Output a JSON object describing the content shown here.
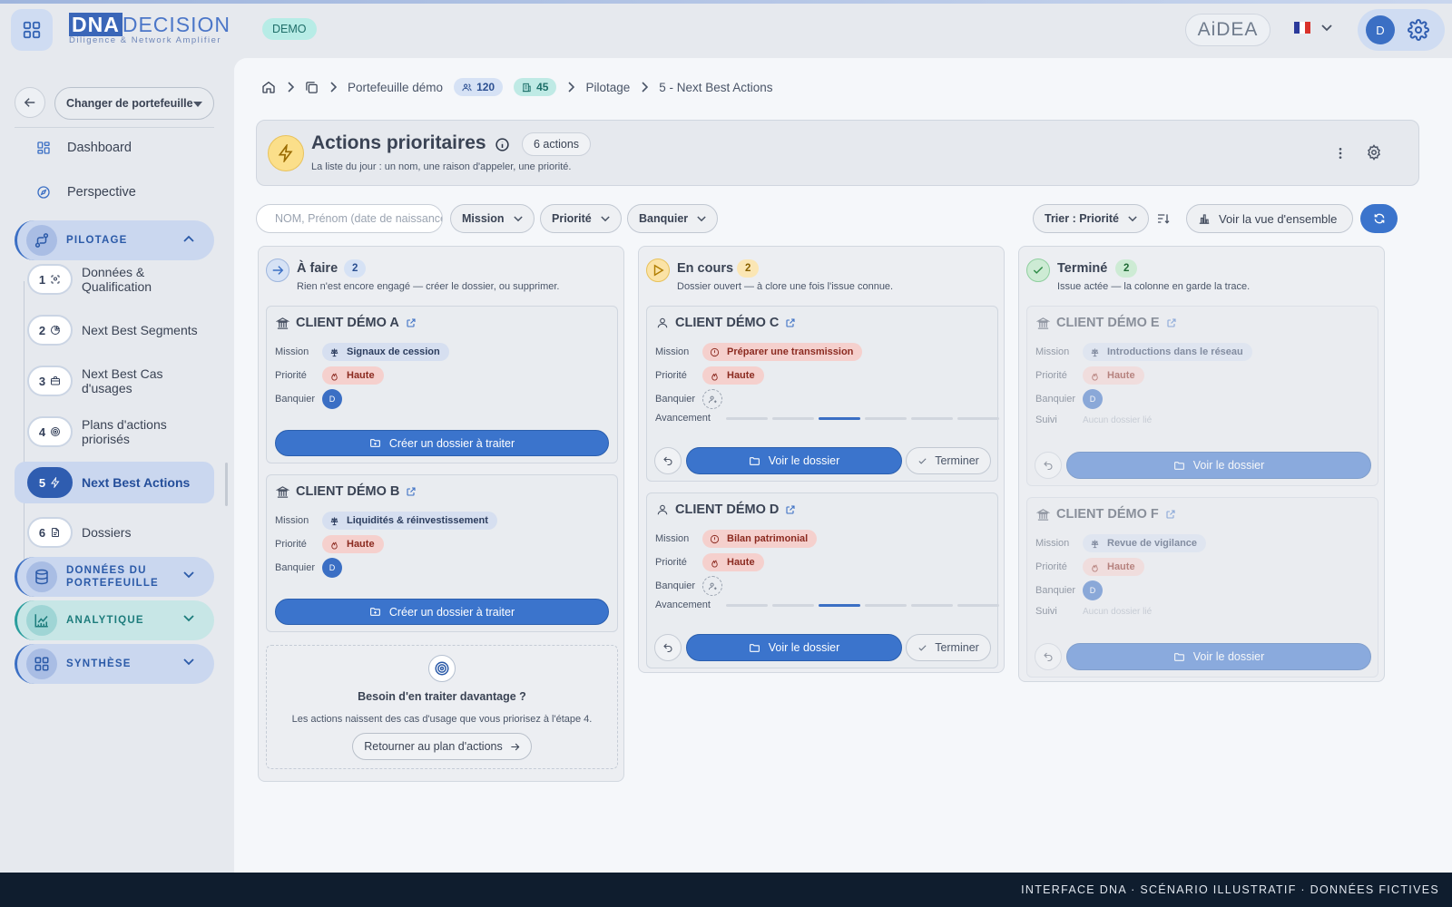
{
  "app": {
    "logo_main_a": "DNA",
    "logo_main_b": "DECISION",
    "logo_sub": "Diligence & Network Amplifier",
    "env_badge": "DEMO",
    "assistant_label": "AiDEA",
    "user_initial": "D"
  },
  "sidebar": {
    "portfolio_button": "Changer de portefeuille",
    "items": [
      {
        "label": "Dashboard",
        "icon": "dashboard-icon"
      },
      {
        "label": "Perspective",
        "icon": "compass-icon"
      }
    ],
    "section_pilotage": "PILOTAGE",
    "steps": [
      {
        "num": "1",
        "label": "Données & Qualification",
        "icon": "scan-icon"
      },
      {
        "num": "2",
        "label": "Next Best Segments",
        "icon": "pie-chart-icon"
      },
      {
        "num": "3",
        "label": "Next Best Cas d'usages",
        "icon": "briefcase-icon"
      },
      {
        "num": "4",
        "label": "Plans d'actions priorisés",
        "icon": "target-icon"
      },
      {
        "num": "5",
        "label": "Next Best Actions",
        "icon": "bolt-icon"
      },
      {
        "num": "6",
        "label": "Dossiers",
        "icon": "document-icon"
      }
    ],
    "sections": [
      {
        "label": "DONNÉES DU PORTEFEUILLE",
        "icon": "database-icon"
      },
      {
        "label": "ANALYTIQUE",
        "icon": "chart-icon"
      },
      {
        "label": "SYNTHÈSE",
        "icon": "grid-icon"
      }
    ]
  },
  "breadcrumb": {
    "portfolio": "Portefeuille démo",
    "people_count": "120",
    "company_count": "45",
    "section": "Pilotage",
    "page": "5 - Next Best Actions"
  },
  "header": {
    "title": "Actions prioritaires",
    "count": "6 actions",
    "subtitle": "La liste du jour : un nom, une raison d'appeler, une priorité."
  },
  "filters": {
    "search_placeholder": "NOM, Prénom (date de naissance)",
    "mission": "Mission",
    "priority": "Priorité",
    "banker": "Banquier",
    "sort": "Trier : Priorité",
    "overview": "Voir la vue d'ensemble"
  },
  "labels": {
    "mission": "Mission",
    "priority": "Priorité",
    "banker": "Banquier",
    "progress": "Avancement",
    "followup": "Suivi",
    "create": "Créer un dossier à traiter",
    "view": "Voir le dossier",
    "finish": "Terminer",
    "no_file": "Aucun dossier lié"
  },
  "columns": [
    {
      "title": "À faire",
      "count": "2",
      "subtitle": "Rien n'est encore engagé — créer le dossier, ou supprimer.",
      "cards": [
        {
          "name": "CLIENT DÉMO A",
          "mission": "Signaux de cession",
          "priority": "Haute",
          "banker": "D"
        },
        {
          "name": "CLIENT DÉMO B",
          "mission": "Liquidités & réinvestissement",
          "priority": "Haute",
          "banker": "D"
        }
      ]
    },
    {
      "title": "En cours",
      "count": "2",
      "subtitle": "Dossier ouvert — à clore une fois l'issue connue.",
      "cards": [
        {
          "name": "CLIENT DÉMO C",
          "mission": "Préparer une transmission",
          "priority": "Haute",
          "progress_step": 3,
          "progress_total": 6
        },
        {
          "name": "CLIENT DÉMO D",
          "mission": "Bilan patrimonial",
          "priority": "Haute",
          "progress_step": 3,
          "progress_total": 6
        }
      ]
    },
    {
      "title": "Terminé",
      "count": "2",
      "subtitle": "Issue actée — la colonne en garde la trace.",
      "cards": [
        {
          "name": "CLIENT DÉMO E",
          "mission": "Introductions dans le réseau",
          "priority": "Haute",
          "banker": "D"
        },
        {
          "name": "CLIENT DÉMO F",
          "mission": "Revue de vigilance",
          "priority": "Haute",
          "banker": "D"
        }
      ]
    }
  ],
  "more": {
    "title": "Besoin d'en traiter davantage ?",
    "text": "Les actions naissent des cas d'usage que vous priorisez à l'étape 4.",
    "button": "Retourner au plan d'actions"
  },
  "footer": "INTERFACE DNA · SCÉNARIO ILLUSTRATIF · DONNÉES FICTIVES",
  "colors": {
    "primary": "#3b74cc",
    "teal": "#2a9d9d",
    "priority_bg": "#f5d0cd",
    "footer_bg": "#0f1d2e"
  }
}
